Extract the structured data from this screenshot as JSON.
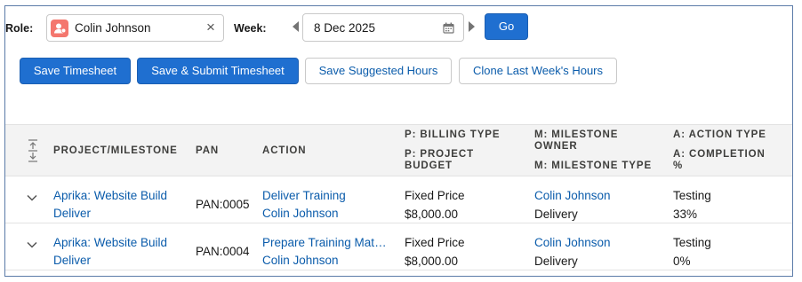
{
  "filters": {
    "role_label": "Role:",
    "role_value": "Colin Johnson",
    "clear_glyph": "×",
    "week_label": "Week:",
    "week_value": "8 Dec 2025",
    "go_label": "Go"
  },
  "actions": {
    "save_timesheet": "Save Timesheet",
    "save_submit": "Save & Submit Timesheet",
    "save_suggested": "Save Suggested Hours",
    "clone_last_week": "Clone Last Week's Hours"
  },
  "table": {
    "headers": {
      "project_milestone": "PROJECT/MILESTONE",
      "pan": "PAN",
      "action": "ACTION",
      "billing_type": "P: BILLING TYPE",
      "project_budget_1": "P: PROJECT",
      "project_budget_2": "BUDGET",
      "milestone_owner_1": "M: MILESTONE",
      "milestone_owner_2": "OWNER",
      "milestone_type": "M: MILESTONE TYPE",
      "action_type": "A: ACTION TYPE",
      "completion_1": "A: COMPLETION",
      "completion_2": "%"
    },
    "rows": [
      {
        "project": "Aprika: Website Build",
        "milestone": "Deliver",
        "pan": "PAN:0005",
        "action": "Deliver Training",
        "action_owner": "Colin Johnson",
        "billing_type": "Fixed Price",
        "budget": "$8,000.00",
        "milestone_owner": "Colin Johnson",
        "milestone_type": "Delivery",
        "action_type": "Testing",
        "completion": "33%"
      },
      {
        "project": "Aprika: Website Build",
        "milestone": "Deliver",
        "pan": "PAN:0004",
        "action": "Prepare Training Mater…",
        "action_owner": "Colin Johnson",
        "billing_type": "Fixed Price",
        "budget": "$8,000.00",
        "milestone_owner": "Colin Johnson",
        "milestone_type": "Delivery",
        "action_type": "Testing",
        "completion": "0%"
      }
    ]
  },
  "colors": {
    "brand": "#1f6fd0",
    "link": "#0b5cab",
    "avatar": "#f4776e",
    "header_bg": "#f3f3f3"
  },
  "icons": [
    "user-avatar-icon",
    "close-icon",
    "caret-left-icon",
    "calendar-icon",
    "caret-right-icon",
    "column-resize-icon",
    "chevron-down-icon"
  ]
}
